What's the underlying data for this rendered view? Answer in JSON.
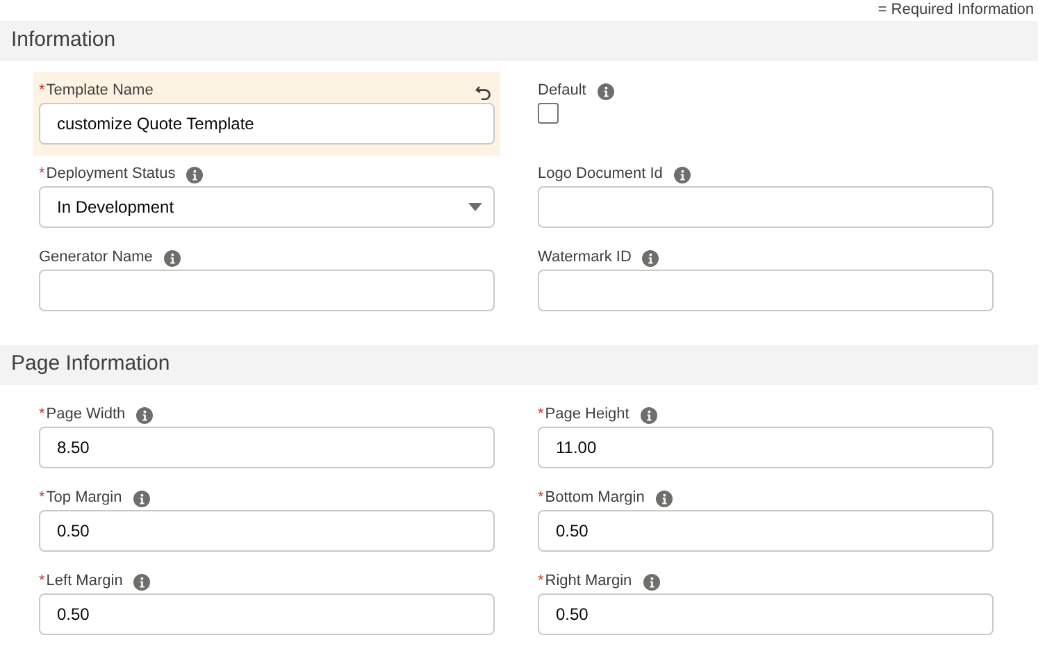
{
  "required_note": "= Required Information",
  "sections": [
    {
      "title": "Information",
      "fields": [
        {
          "kind": "text",
          "mark": "*",
          "label": "Template Name",
          "info": false,
          "value": "customize Quote Template",
          "edited": true
        },
        {
          "kind": "checkbox",
          "label": "Default",
          "info": true,
          "checked": false,
          "edited": false
        },
        {
          "kind": "select",
          "mark": "*",
          "label": "Deployment Status",
          "info": true,
          "value": "In Development",
          "edited": false
        },
        {
          "kind": "text",
          "label": "Logo Document Id",
          "info": true,
          "edited": false
        },
        {
          "kind": "text",
          "label": "Generator Name",
          "info": true,
          "edited": false
        },
        {
          "kind": "text",
          "label": "Watermark ID",
          "info": true,
          "edited": false
        }
      ]
    },
    {
      "title": "Page Information",
      "fields": [
        {
          "kind": "text",
          "mark": "*",
          "label": "Page Width",
          "info": true,
          "value": "8.50",
          "edited": false
        },
        {
          "kind": "text",
          "mark": "*",
          "label": "Page Height",
          "info": true,
          "value": "11.00",
          "edited": false
        },
        {
          "kind": "text",
          "mark": "*",
          "label": "Top Margin",
          "info": true,
          "value": "0.50",
          "edited": false
        },
        {
          "kind": "text",
          "mark": "*",
          "label": "Bottom Margin",
          "info": true,
          "value": "0.50",
          "edited": false
        },
        {
          "kind": "text",
          "mark": "*",
          "label": "Left Margin",
          "info": true,
          "value": "0.50",
          "edited": false
        },
        {
          "kind": "text",
          "mark": "*",
          "label": "Right Margin",
          "info": true,
          "value": "0.50",
          "edited": false
        }
      ]
    }
  ]
}
